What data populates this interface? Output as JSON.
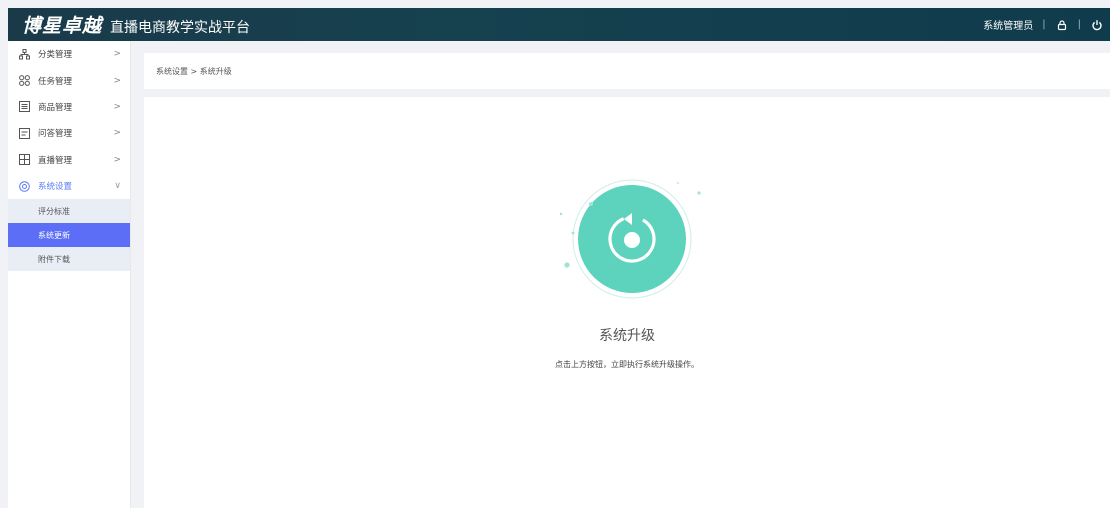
{
  "header": {
    "brand_logo": "博星卓越",
    "brand_sub": "直播电商教学实战平台",
    "user_label": "系统管理员",
    "separator": "|"
  },
  "sidebar": {
    "items": [
      {
        "label": "分类管理",
        "icon": "category-icon"
      },
      {
        "label": "任务管理",
        "icon": "task-icon"
      },
      {
        "label": "商品管理",
        "icon": "product-icon"
      },
      {
        "label": "问答管理",
        "icon": "qa-icon"
      },
      {
        "label": "直播管理",
        "icon": "live-icon"
      },
      {
        "label": "系统设置",
        "icon": "settings-icon"
      }
    ],
    "submenu": [
      {
        "label": "评分标准"
      },
      {
        "label": "系统更新"
      },
      {
        "label": "附件下载"
      }
    ],
    "arrow_right": ">",
    "arrow_down": "∨"
  },
  "breadcrumb": "系统设置 > 系统升级",
  "upgrade": {
    "title": "系统升级",
    "description": "点击上方按钮，立即执行系统升级操作。"
  },
  "colors": {
    "header": "#16414f",
    "accent": "#5b6ef5",
    "teal": "#5dd3bd"
  }
}
